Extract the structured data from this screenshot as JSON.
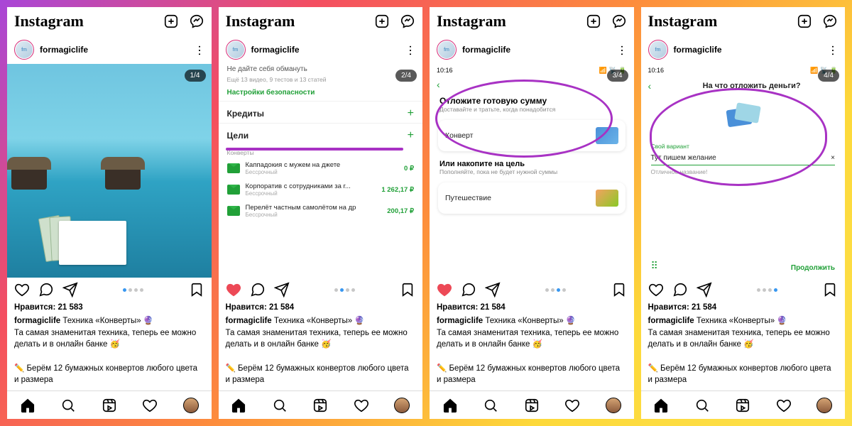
{
  "logo": "Instagram",
  "username": "formagiclife",
  "likes_label_a": "Нравится: 21 583",
  "likes_label_b": "Нравится: 21 584",
  "caption_title": "Техника «Конверты» 🔮",
  "caption_line1": "Та самая знаменитая техника, теперь ее можно делать и в онлайн банке 🥳",
  "caption_line2": "✏️ Берём 12 бумажных конвертов любого цвета и размера",
  "counters": [
    "1/4",
    "2/4",
    "3/4",
    "4/4"
  ],
  "slide2": {
    "h1": "Не дайте себя обмануть",
    "sub": "Ещё 13 видео, 9 тестов и 13 статей",
    "link": "Настройки безопасности",
    "sec1": "Кредиты",
    "sec2": "Цели",
    "grp": "Конверты",
    "goals": [
      {
        "n": "Каппадокия с мужем на джете",
        "s": "Бессрочный",
        "a": "0 ₽"
      },
      {
        "n": "Корпоратив с сотрудниками за г...",
        "s": "Бессрочный",
        "a": "1 262,17 ₽"
      },
      {
        "n": "Перелёт частным самолётом на др",
        "s": "Бессрочный",
        "a": "200,17 ₽"
      }
    ]
  },
  "slide3": {
    "time": "10:16",
    "t1": "Отложите готовую сумму",
    "s1": "Доставайте и тратьте, когда понадобится",
    "card1": "Конверт",
    "t2": "Или накопите на цель",
    "s2": "Пополняйте, пока не будет нужной суммы",
    "card2": "Путешествие"
  },
  "slide4": {
    "time": "10:16",
    "q": "На что отложить деньги?",
    "label": "Свой вариант",
    "val": "Тут пишем желание",
    "hint": "Отличное название!",
    "btn": "Продолжить"
  }
}
